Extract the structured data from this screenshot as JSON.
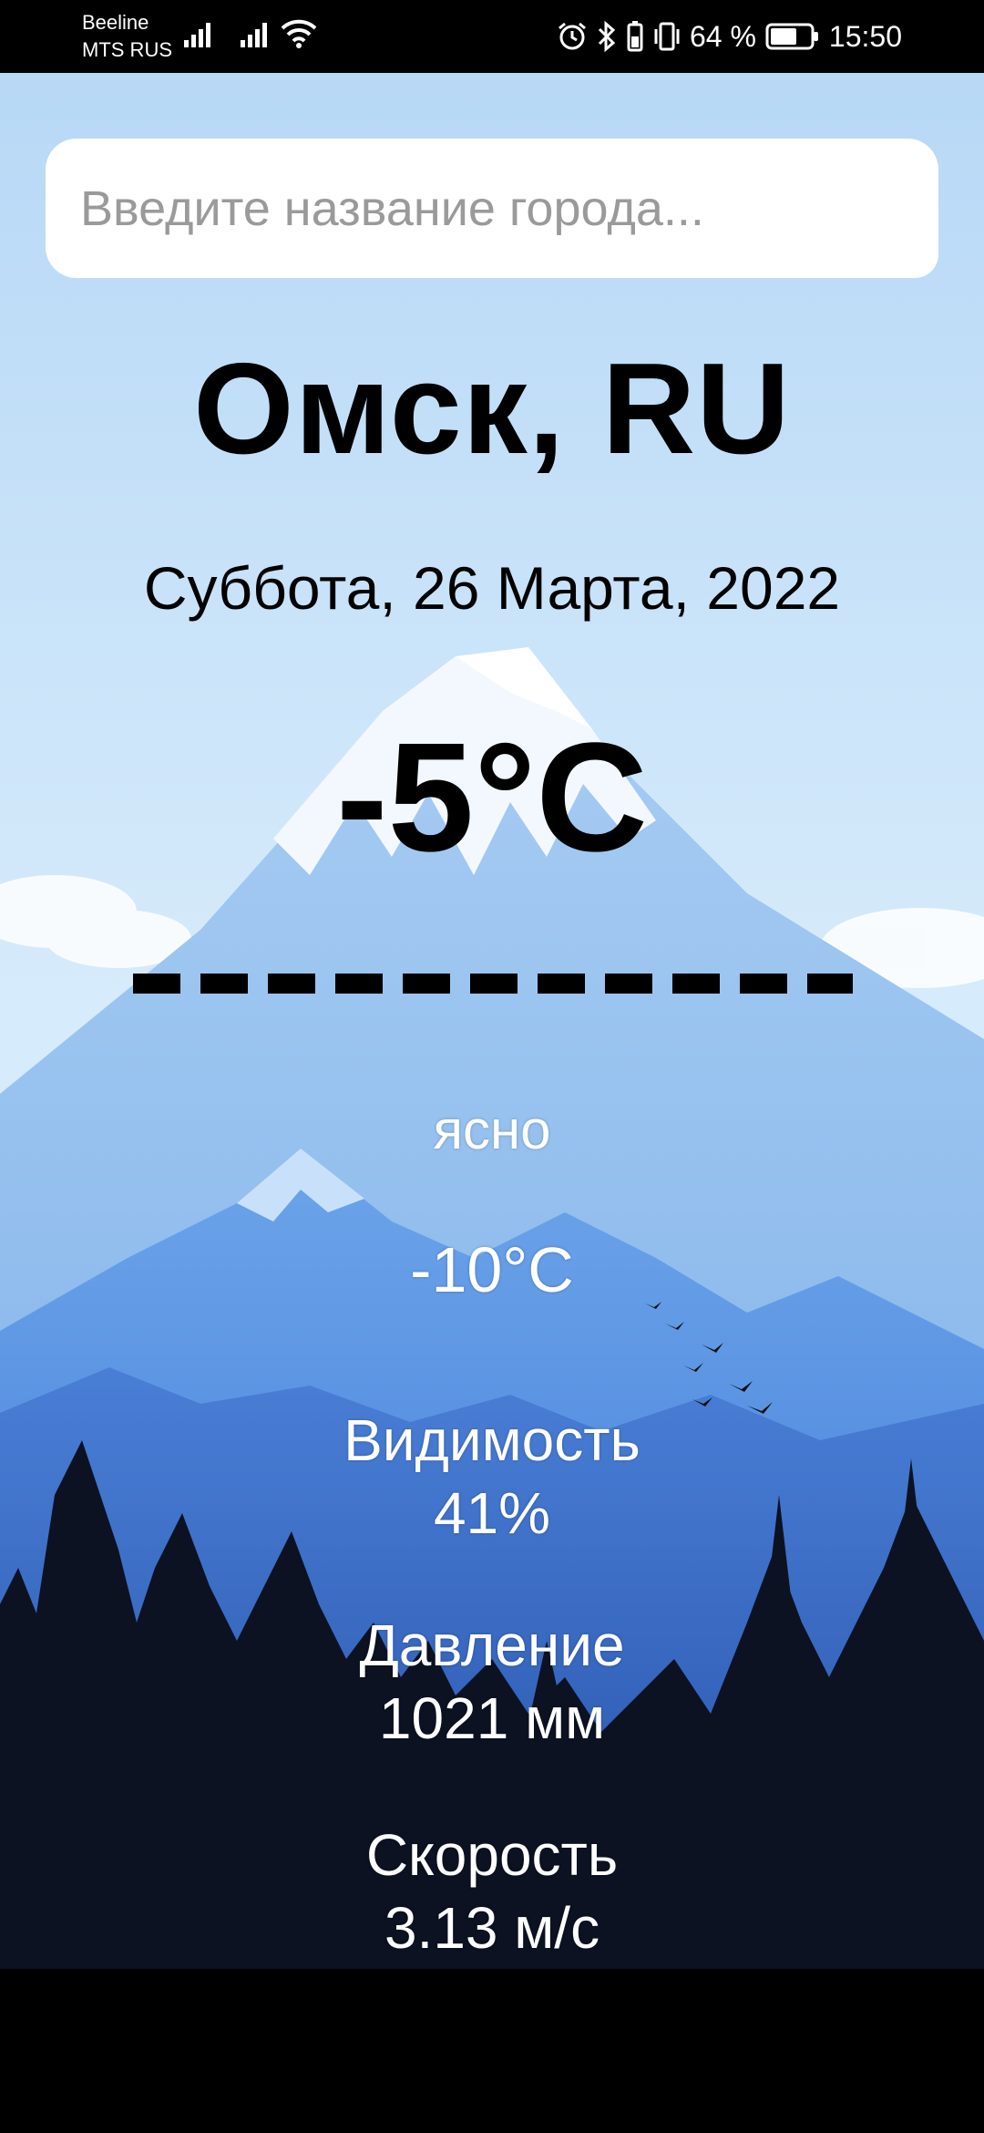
{
  "status_bar": {
    "carrier_1": "Beeline",
    "carrier_2": "MTS RUS",
    "battery": "64 %",
    "time": "15:50"
  },
  "search": {
    "placeholder": "Введите название города..."
  },
  "weather": {
    "city": "Омск, RU",
    "date": "Суббота, 26 Марта, 2022",
    "temperature": "-5°C",
    "divider": "-----------",
    "condition": "ясно",
    "feels_like": "-10°C",
    "visibility_label": "Видимость",
    "visibility_value": "41%",
    "pressure_label": "Давление",
    "pressure_value": "1021 мм",
    "wind_label": "Скорость",
    "wind_value": "3.13 м/с"
  },
  "icons": [
    "signal-icon",
    "wifi-icon",
    "alarm-icon",
    "bluetooth-icon",
    "battery-saver-icon",
    "vibrate-icon",
    "battery-icon"
  ],
  "colors": {
    "sky": "#bcdcf7",
    "mountain_far": "#9cc6f0",
    "mountain_mid": "#5b95e3",
    "mountain_near": "#3f73cf",
    "forest": "#0b0f1c"
  }
}
